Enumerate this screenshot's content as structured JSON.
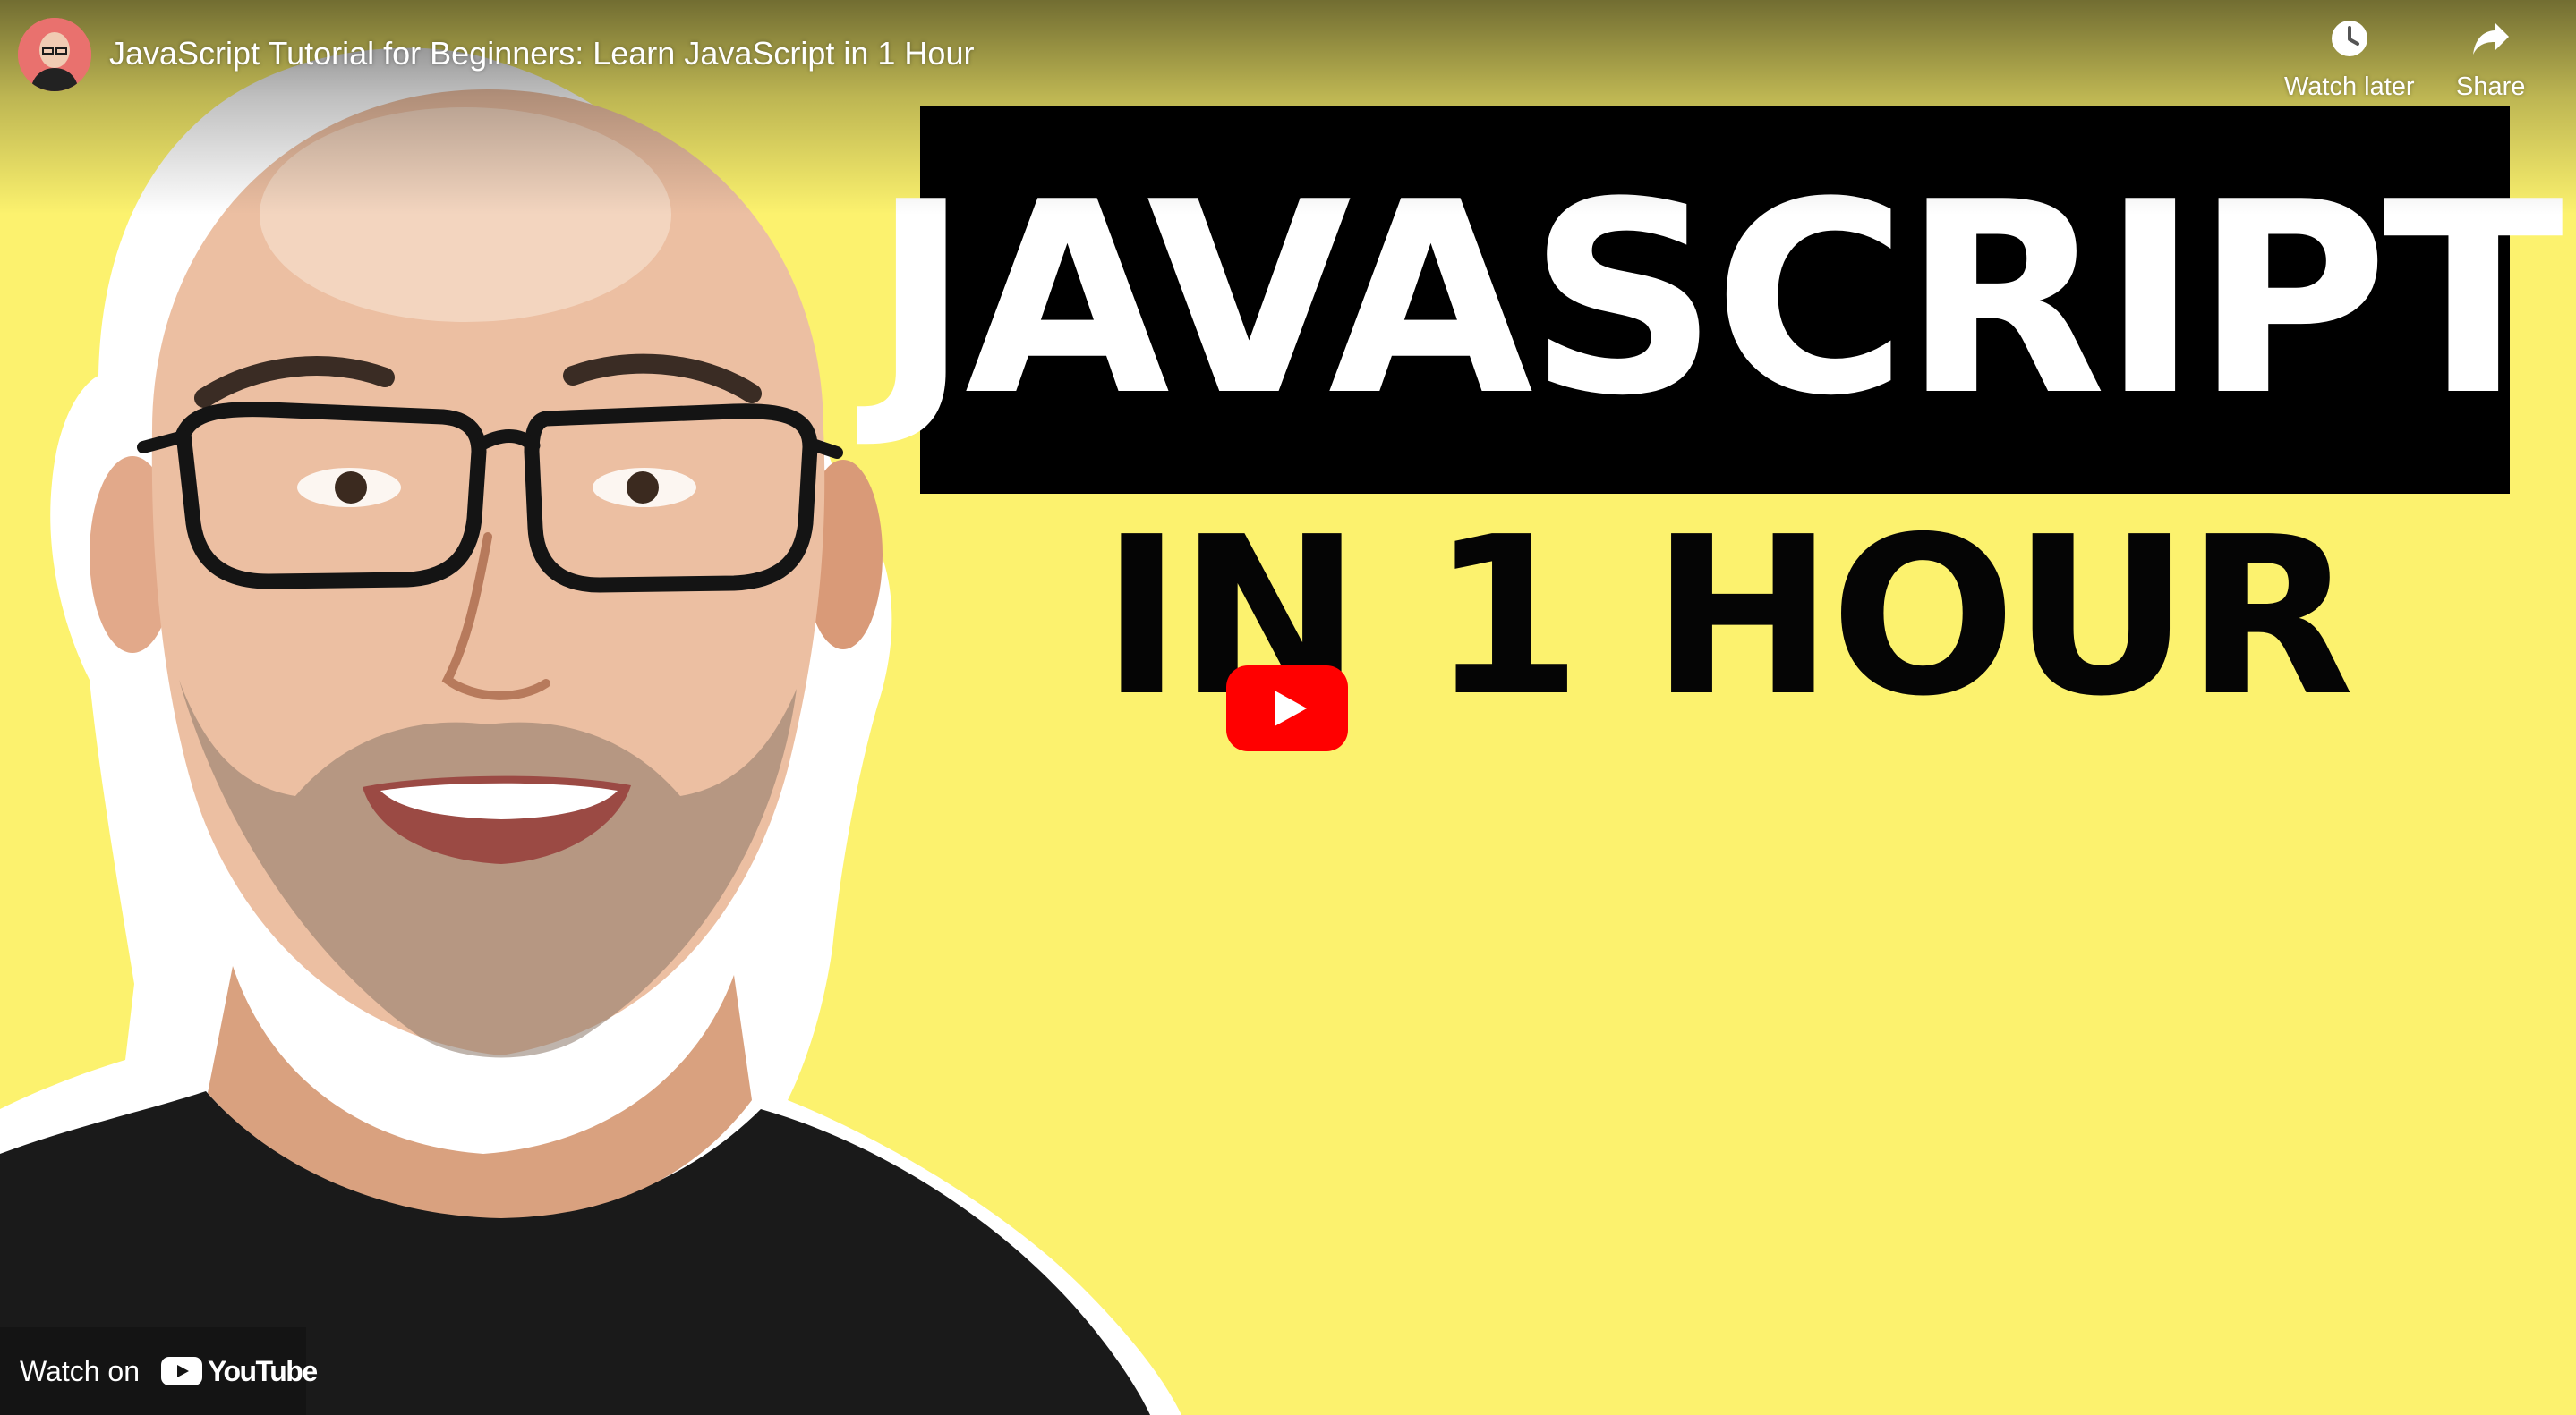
{
  "player": {
    "title": "JavaScript Tutorial for Beginners: Learn JavaScript in 1 Hour",
    "actions": {
      "watch_later_label": "Watch later",
      "share_label": "Share"
    },
    "watch_on_label": "Watch on",
    "youtube_wordmark": "YouTube"
  },
  "thumbnail": {
    "headline": "JAVASCRIPT",
    "subheadline": "IN 1 HOUR",
    "background_color": "#FCF26E",
    "headline_box_color": "#000000",
    "headline_text_color": "#FFFFFF",
    "subheadline_text_color": "#050505"
  },
  "icons": {
    "watch_later": "clock-icon",
    "share": "share-arrow-icon",
    "play": "youtube-play-icon",
    "youtube_logo": "youtube-logo-icon"
  },
  "colors": {
    "play_button": "#FF0000",
    "overlay_text": "#FFFFFF"
  }
}
